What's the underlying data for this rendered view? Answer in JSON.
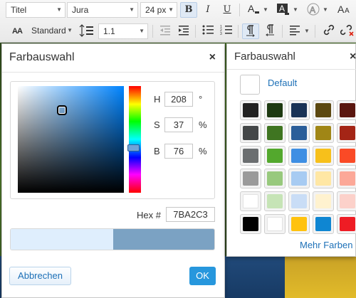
{
  "toolbar": {
    "paragraph_format": "Titel",
    "font_family": "Jura",
    "font_size": "24 px",
    "line_height_mode": "Standard",
    "line_height_value": "1.1",
    "bold_label": "B",
    "italic_label": "I",
    "underline_label": "U",
    "text_style_label": "AA"
  },
  "color_dialog": {
    "title": "Farbauswahl",
    "close_glyph": "×",
    "h_label": "H",
    "h_value": "208",
    "h_unit": "°",
    "s_label": "S",
    "s_value": "37",
    "s_unit": "%",
    "b_label": "B",
    "b_value": "76",
    "b_unit": "%",
    "hex_label": "Hex #",
    "hex_value": "7BA2C3",
    "old_color": "#dfeefd",
    "new_color": "#7BA2C3",
    "cancel_label": "Abbrechen",
    "ok_label": "OK"
  },
  "swatch_panel": {
    "title": "Farbauswahl",
    "close_glyph": "×",
    "default_label": "Default",
    "more_label": "Mehr Farben",
    "rows": [
      [
        "#222222",
        "#1e3a12",
        "#1a3356",
        "#5c4810",
        "#5a160f"
      ],
      [
        "#444748",
        "#3f7521",
        "#2b5e99",
        "#a08616",
        "#a42516"
      ],
      [
        "#6b6e70",
        "#53a82d",
        "#3f8fe3",
        "#f7c01b",
        "#fa4a26"
      ],
      [
        "#9a9a9a",
        "#98c97d",
        "#a7cbf2",
        "#ffe7a4",
        "#fca898"
      ],
      [
        "#ffffff",
        "#c6e4b6",
        "#c9ddf6",
        "#fff2cf",
        "#fcd1ca"
      ],
      [
        "#000000",
        "#ffffff",
        "#ffc20e",
        "#0f86d2",
        "#ee1c24"
      ]
    ]
  }
}
